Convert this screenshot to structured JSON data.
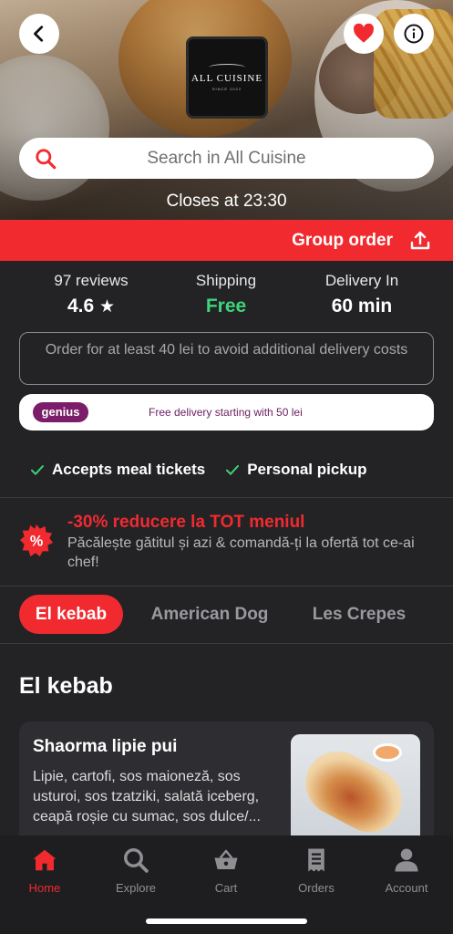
{
  "header": {
    "logo_name": "ALL CUISINE",
    "logo_since": "SINCE 2022",
    "search_placeholder": "Search in All Cuisine",
    "closes_text": "Closes at 23:30"
  },
  "group_order": {
    "label": "Group order"
  },
  "stats": {
    "reviews_label": "97 reviews",
    "rating": "4.6",
    "shipping_label": "Shipping",
    "shipping_value": "Free",
    "delivery_label": "Delivery In",
    "delivery_value": "60 min"
  },
  "min_order_notice": "Order for at least 40 lei to avoid additional delivery costs",
  "genius": {
    "badge": "genius",
    "text": "Free delivery starting with 50 lei"
  },
  "features": [
    {
      "label": "Accepts meal tickets"
    },
    {
      "label": "Personal pickup"
    }
  ],
  "promo": {
    "title": "-30% reducere la TOT meniul",
    "description": "Păcălește gătitul și azi & comandă-ți la ofertă tot ce-ai chef!"
  },
  "categories": [
    {
      "label": "El kebab",
      "active": true
    },
    {
      "label": "American Dog",
      "active": false
    },
    {
      "label": "Les Crepes",
      "active": false
    }
  ],
  "section_title": "El kebab",
  "menu_item": {
    "name": "Shaorma lipie pui",
    "description": "Lipie, cartofi, sos maioneză, sos usturoi, sos tzatziki, salată iceberg, ceapă roșie cu sumac, sos dulce/..."
  },
  "bottom_nav": [
    {
      "label": "Home",
      "icon": "home-icon",
      "active": true
    },
    {
      "label": "Explore",
      "icon": "search-icon",
      "active": false
    },
    {
      "label": "Cart",
      "icon": "basket-icon",
      "active": false
    },
    {
      "label": "Orders",
      "icon": "receipt-icon",
      "active": false
    },
    {
      "label": "Account",
      "icon": "person-icon",
      "active": false
    }
  ],
  "colors": {
    "accent": "#f12a2f",
    "success": "#3dd47a",
    "background": "#232326",
    "genius": "#7b1d6a"
  }
}
